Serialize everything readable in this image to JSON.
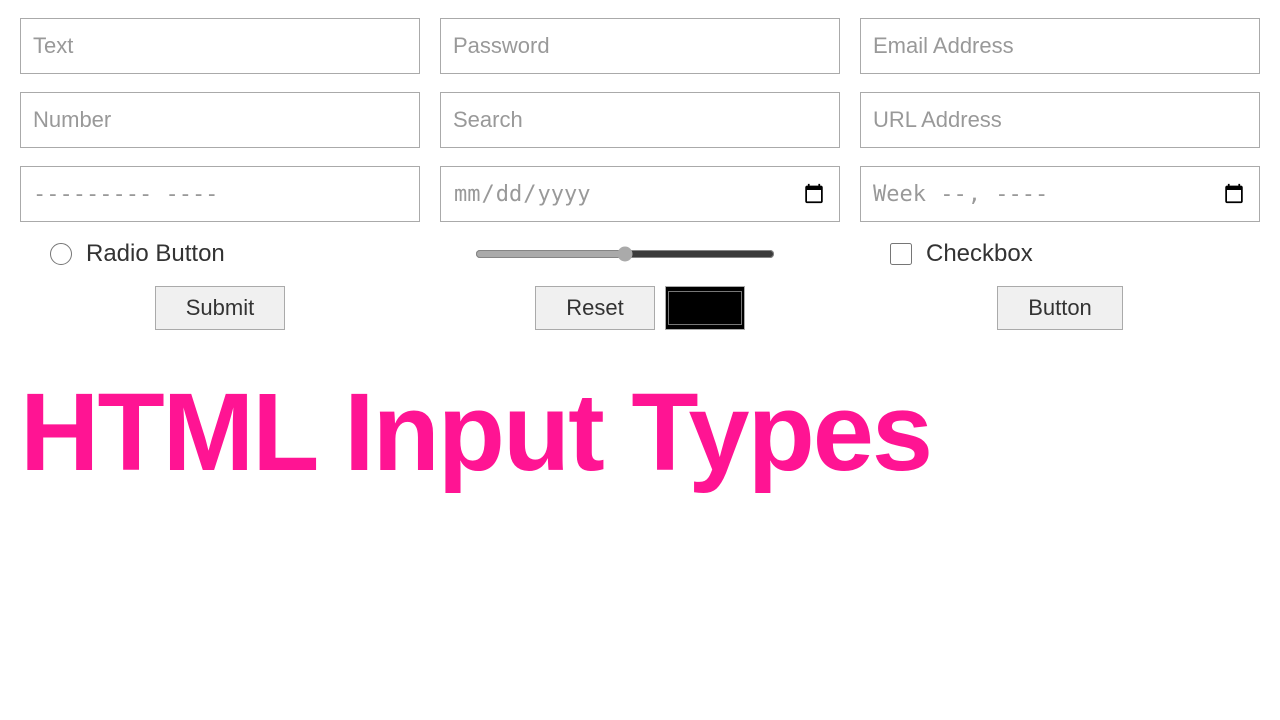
{
  "inputs": {
    "row1": {
      "text_placeholder": "Text",
      "password_placeholder": "Password",
      "email_placeholder": "Email Address"
    },
    "row2": {
      "number_placeholder": "Number",
      "search_placeholder": "Search",
      "url_placeholder": "URL Address"
    },
    "row3": {
      "phone_value": "--------- ----",
      "date_placeholder": "mm/dd/yyyy",
      "week_value": "Week  --,  ----"
    },
    "row4": {
      "radio_label": "Radio Button",
      "range_value": "50",
      "checkbox_label": "Checkbox"
    },
    "row5": {
      "submit_label": "Submit",
      "reset_label": "Reset",
      "button_label": "Button"
    }
  },
  "title": {
    "text": "HTML Input Types",
    "color": "#ff1493"
  }
}
